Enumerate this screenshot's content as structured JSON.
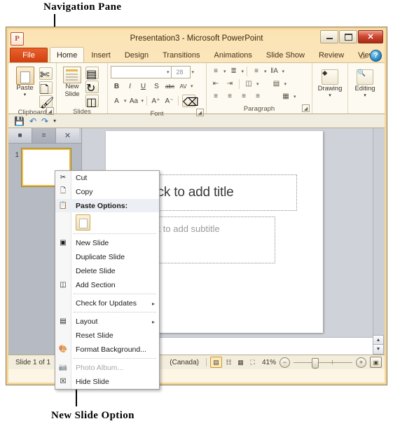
{
  "annotations": {
    "top": "Navigation Pane",
    "bottom": "New Slide Option"
  },
  "window": {
    "app_icon": "P",
    "title": "Presentation3  -  Microsoft PowerPoint",
    "controls": {
      "minimize": "minimize-icon",
      "restore": "restore-icon",
      "close": "✕"
    }
  },
  "ribbon": {
    "file_tab": "File",
    "tabs": [
      {
        "label": "Home",
        "active": true
      },
      {
        "label": "Insert",
        "active": false
      },
      {
        "label": "Design",
        "active": false
      },
      {
        "label": "Transitions",
        "active": false
      },
      {
        "label": "Animations",
        "active": false
      },
      {
        "label": "Slide Show",
        "active": false
      },
      {
        "label": "Review",
        "active": false
      },
      {
        "label": "View",
        "active": false
      }
    ],
    "collapse_icon": "chevron-up-icon",
    "help_icon": "?",
    "groups": [
      {
        "name": "Clipboard",
        "has_launcher": true
      },
      {
        "name": "Slides",
        "has_launcher": false
      },
      {
        "name": "Font",
        "has_launcher": true
      },
      {
        "name": "Paragraph",
        "has_launcher": true
      }
    ],
    "clipboard": {
      "paste_label": "Paste",
      "paste_caret": "▾"
    },
    "slides": {
      "new_slide_label_line1": "New",
      "new_slide_label_line2": "Slide",
      "caret": "▾"
    },
    "font": {
      "font_name_value": "",
      "font_size_value": "28",
      "bold": "B",
      "italic": "I",
      "underline": "U",
      "shadow": "S",
      "strikethrough": "abc",
      "spacing": "AV",
      "font_color": "A",
      "change_case": "Aa",
      "grow": "A⁺",
      "shrink": "A⁻",
      "clear_format": "clear-formatting-icon"
    },
    "paragraph": {
      "bullets": "bullets-icon",
      "numbering": "numbering-icon",
      "line_spacing": "line-spacing-icon",
      "text_direction": "text-direction-icon",
      "decrease_indent": "decrease-indent-icon",
      "increase_indent": "increase-indent-icon",
      "columns": "columns-icon",
      "align_text": "align-text-icon",
      "align_left": "align-left-icon",
      "align_center": "align-center-icon",
      "align_right": "align-right-icon",
      "justify": "justify-icon",
      "smartart": "smartart-icon"
    },
    "drawing": {
      "label": "Drawing",
      "caret": "▾"
    },
    "editing": {
      "label": "Editing",
      "caret": "▾"
    }
  },
  "quick_access": {
    "save": "save-icon",
    "undo": "undo-icon",
    "redo": "redo-icon",
    "customize": "▾"
  },
  "navigation_pane": {
    "tabs": [
      {
        "name": "outline-tab",
        "glyph": "■"
      },
      {
        "name": "slides-tab",
        "glyph": "≡",
        "selected": true
      },
      {
        "name": "close-pane-tab",
        "glyph": "✕"
      }
    ],
    "slides": [
      {
        "number": "1"
      }
    ]
  },
  "slide": {
    "title_placeholder": "Click to add title",
    "subtitle_placeholder": "Click to add subtitle"
  },
  "context_menu": {
    "items": [
      {
        "label": "Cut",
        "icon": "cut-icon",
        "type": "item",
        "accel": 2
      },
      {
        "label": "Copy",
        "icon": "copy-icon",
        "type": "item",
        "accel": 0
      },
      {
        "label": "Paste Options:",
        "icon": "paste-icon",
        "type": "header"
      },
      {
        "label": "",
        "icon": "paste-keep-formatting-icon",
        "type": "paste-gallery"
      },
      {
        "type": "separator"
      },
      {
        "label": "New Slide",
        "icon": "new-slide-icon",
        "type": "item",
        "accel": 0
      },
      {
        "label": "Duplicate Slide",
        "icon": "",
        "type": "item",
        "accel": 0
      },
      {
        "label": "Delete Slide",
        "icon": "",
        "type": "item",
        "accel": 0
      },
      {
        "label": "Add Section",
        "icon": "add-section-icon",
        "type": "item",
        "accel": 0
      },
      {
        "type": "separator"
      },
      {
        "label": "Check for Updates",
        "icon": "",
        "type": "submenu",
        "arrow": "▸"
      },
      {
        "type": "separator"
      },
      {
        "label": "Layout",
        "icon": "layout-icon",
        "type": "submenu",
        "arrow": "▸"
      },
      {
        "label": "Reset Slide",
        "icon": "",
        "type": "item",
        "accel": 0
      },
      {
        "label": "Format Background...",
        "icon": "format-background-icon",
        "type": "item",
        "accel": 0
      },
      {
        "type": "separator"
      },
      {
        "label": "Photo Album...",
        "icon": "photo-album-icon",
        "type": "disabled"
      },
      {
        "label": "Hide Slide",
        "icon": "hide-slide-icon",
        "type": "item",
        "accel": 0
      }
    ]
  },
  "status_bar": {
    "slide_count": "Slide 1 of 1",
    "language": "(Canada)",
    "views": [
      {
        "name": "normal-view-button",
        "glyph": "▤",
        "active": true
      },
      {
        "name": "slide-sorter-button",
        "glyph": "☷",
        "active": false
      },
      {
        "name": "reading-view-button",
        "glyph": "▦",
        "active": false
      },
      {
        "name": "slide-show-button",
        "glyph": "⛶",
        "active": false
      }
    ],
    "zoom": "41%",
    "zoom_out": "−",
    "zoom_in": "+",
    "fit_to_window": "fit-slide-icon"
  },
  "colors": {
    "window_border": "#8a7b55",
    "ribbon_bg": "#fdfaf2",
    "file_tab": "#d1400f",
    "close_button": "#cf4a32",
    "thumb_selected": "#e8b93f",
    "workarea": "#cfd2d8"
  }
}
